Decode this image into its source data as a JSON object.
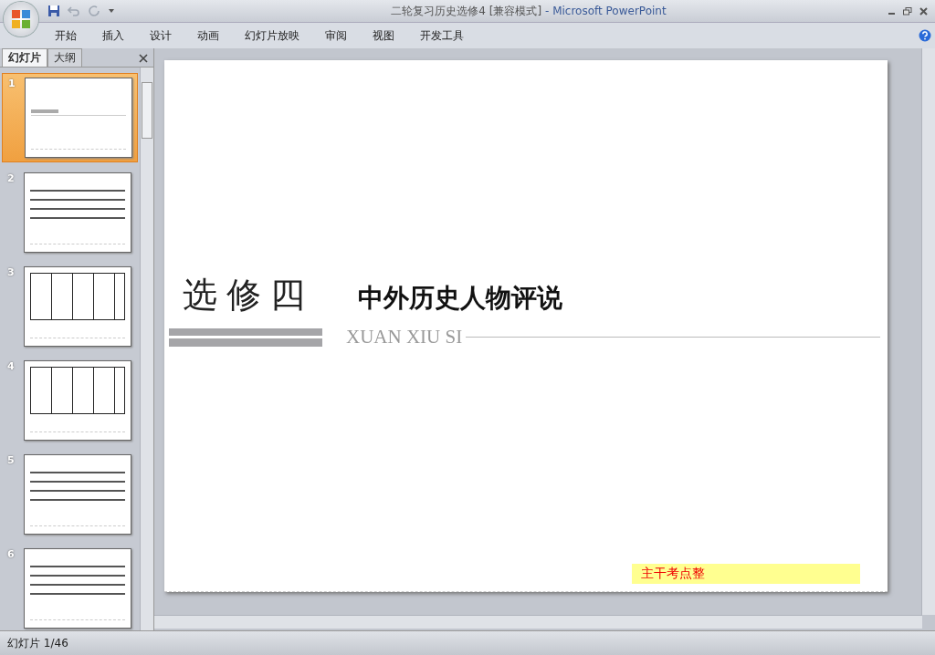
{
  "window": {
    "title": "二轮复习历史选修4 [兼容模式]",
    "app_name": "- Microsoft PowerPoint"
  },
  "ribbon_tabs": [
    {
      "label": "开始"
    },
    {
      "label": "插入"
    },
    {
      "label": "设计"
    },
    {
      "label": "动画"
    },
    {
      "label": "幻灯片放映"
    },
    {
      "label": "审阅"
    },
    {
      "label": "视图"
    },
    {
      "label": "开发工具"
    }
  ],
  "panel_tabs": [
    {
      "label": "幻灯片",
      "selected": true
    },
    {
      "label": "大纲",
      "selected": false
    }
  ],
  "thumbnails": [
    {
      "number": "1",
      "selected": true,
      "kind": "title"
    },
    {
      "number": "2",
      "selected": false,
      "kind": "text"
    },
    {
      "number": "3",
      "selected": false,
      "kind": "table"
    },
    {
      "number": "4",
      "selected": false,
      "kind": "table"
    },
    {
      "number": "5",
      "selected": false,
      "kind": "text"
    },
    {
      "number": "6",
      "selected": false,
      "kind": "text"
    }
  ],
  "slide": {
    "label": "选修四",
    "title": "中外历史人物评说",
    "subtitle": "XUAN XIU SI",
    "footer": "主干考点整"
  },
  "status_bar": {
    "slide_counter": "幻灯片 1/46"
  }
}
